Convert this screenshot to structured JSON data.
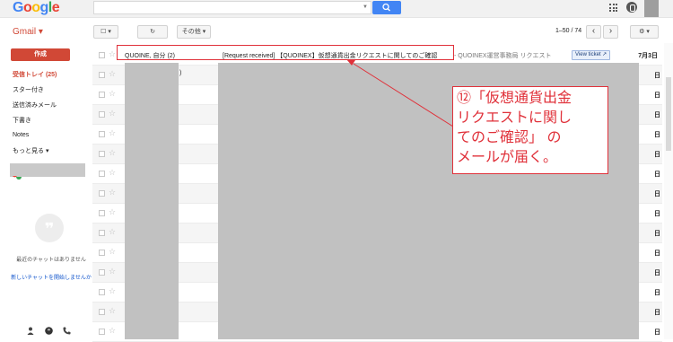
{
  "header": {
    "logo_letters": [
      {
        "ch": "G",
        "color": "#4285f4"
      },
      {
        "ch": "o",
        "color": "#ea4335"
      },
      {
        "ch": "o",
        "color": "#fbbc05"
      },
      {
        "ch": "g",
        "color": "#4285f4"
      },
      {
        "ch": "l",
        "color": "#34a853"
      },
      {
        "ch": "e",
        "color": "#ea4335"
      }
    ],
    "search_placeholder": ""
  },
  "toolbar": {
    "gmail_label": "Gmail ▾",
    "select_label": "☐ ▾",
    "refresh_label": "↻",
    "more_label": "その他 ▾",
    "pager": "1–50 / 74",
    "prev_label": "‹",
    "next_label": "›",
    "settings_label": "⚙ ▾"
  },
  "sidebar": {
    "compose_label": "作成",
    "items": [
      {
        "label": "受信トレイ (25)",
        "active": true
      },
      {
        "label": "スター付き"
      },
      {
        "label": "送信済みメール"
      },
      {
        "label": "下書き"
      },
      {
        "label": "Notes"
      },
      {
        "label": "もっと見る ▾"
      }
    ],
    "chat_empty": "最近のチャットはありません",
    "chat_start": "新しいチャットを開始しませんか"
  },
  "mail": {
    "first_row": {
      "sender": "QUOINE, 自分 (2)",
      "subject": "[Request received] 【QUOINEX】仮想通貨出金リクエストに関してのご確認",
      "snippet": " - QUOINEX運営事務局 リクエスト",
      "view_ticket": "View ticket ↗",
      "date": "7月3日"
    },
    "row2_fragment": ")",
    "date_suffix": "日"
  },
  "annotation": {
    "lines": [
      "⑫「仮想通貨出金",
      "リクエストに関し",
      "てのご確認」 の",
      "メールが届く。"
    ],
    "color": "#e0313a"
  }
}
